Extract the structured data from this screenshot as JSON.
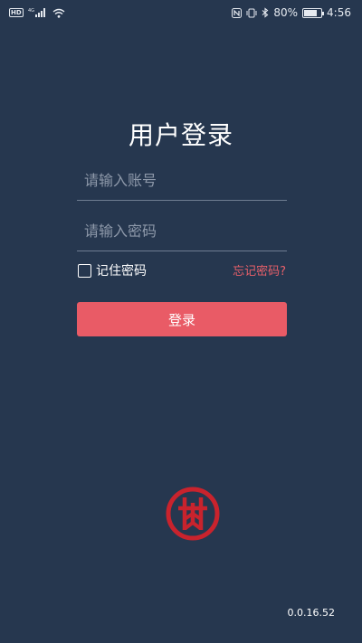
{
  "statusbar": {
    "hd_badge": "HD",
    "net_type": "4G",
    "battery_text": "80%",
    "time": "4:56"
  },
  "login": {
    "title": "用户登录",
    "account_placeholder": "请输入账号",
    "password_placeholder": "请输入密码",
    "remember_label": "记住密码",
    "forgot_label": "忘记密码?",
    "submit_label": "登录"
  },
  "icons": {
    "signal": "signal-icon",
    "wifi": "wifi-icon",
    "nfc": "nfc-icon",
    "vibrate": "vibrate-icon",
    "bluetooth": "bluetooth-icon",
    "battery": "battery-icon",
    "logo": "brand-logo-icon"
  },
  "colors": {
    "background": "#26374f",
    "accent": "#e95b66",
    "link": "#e8606a"
  },
  "battery_level": 0.8,
  "version": "0.0.16.52"
}
